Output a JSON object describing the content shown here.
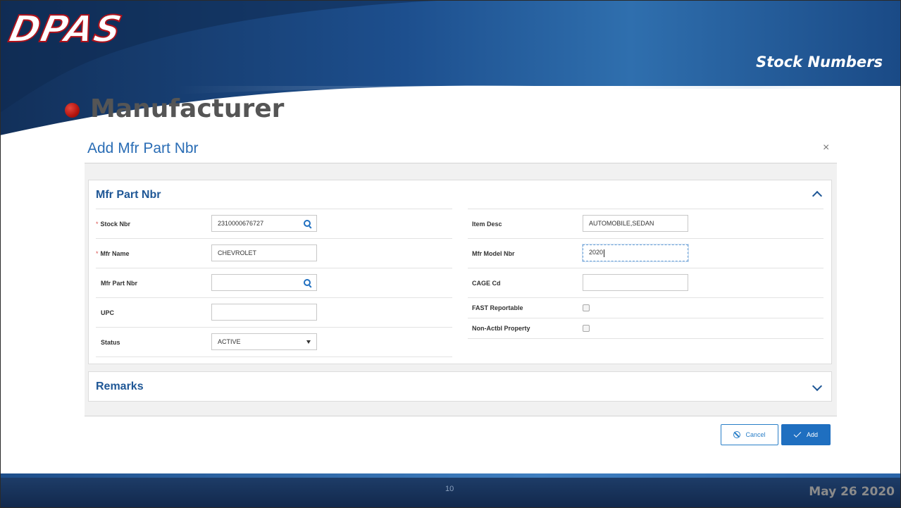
{
  "logo": {
    "text": "DPAS"
  },
  "header": {
    "section_title": "Stock Numbers"
  },
  "slide": {
    "heading": "Manufacturer"
  },
  "dialog": {
    "title": "Add Mfr Part Nbr",
    "close_glyph": "×",
    "panel": {
      "title": "Mfr Part Nbr",
      "left_fields": [
        {
          "label": "Stock Nbr",
          "required": true,
          "value": "2310000676727",
          "lookup": true
        },
        {
          "label": "Mfr Name",
          "required": true,
          "value": "CHEVROLET"
        },
        {
          "label": "Mfr Part Nbr",
          "required": false,
          "value": "",
          "lookup": true
        },
        {
          "label": "UPC",
          "required": false,
          "value": ""
        },
        {
          "label": "Status",
          "required": false,
          "value": "ACTIVE",
          "dropdown": true
        }
      ],
      "right_fields": [
        {
          "label": "Item Desc",
          "value": "AUTOMOBILE,SEDAN"
        },
        {
          "label": "Mfr Model Nbr",
          "value": "2020",
          "focused": true
        },
        {
          "label": "CAGE Cd",
          "value": ""
        }
      ],
      "checkboxes": [
        {
          "label": "FAST Reportable",
          "checked": false
        },
        {
          "label": "Non-Actbl Property",
          "checked": false
        }
      ]
    },
    "remarks": {
      "title": "Remarks"
    },
    "buttons": {
      "cancel": "Cancel",
      "add": "Add"
    }
  },
  "footer": {
    "page_number": "10",
    "date": "May 26 2020"
  },
  "colors": {
    "accent": "#1f6fc0",
    "heading_blue": "#1f5796",
    "banner_dark": "#13325c",
    "bullet": "#b3140e"
  }
}
